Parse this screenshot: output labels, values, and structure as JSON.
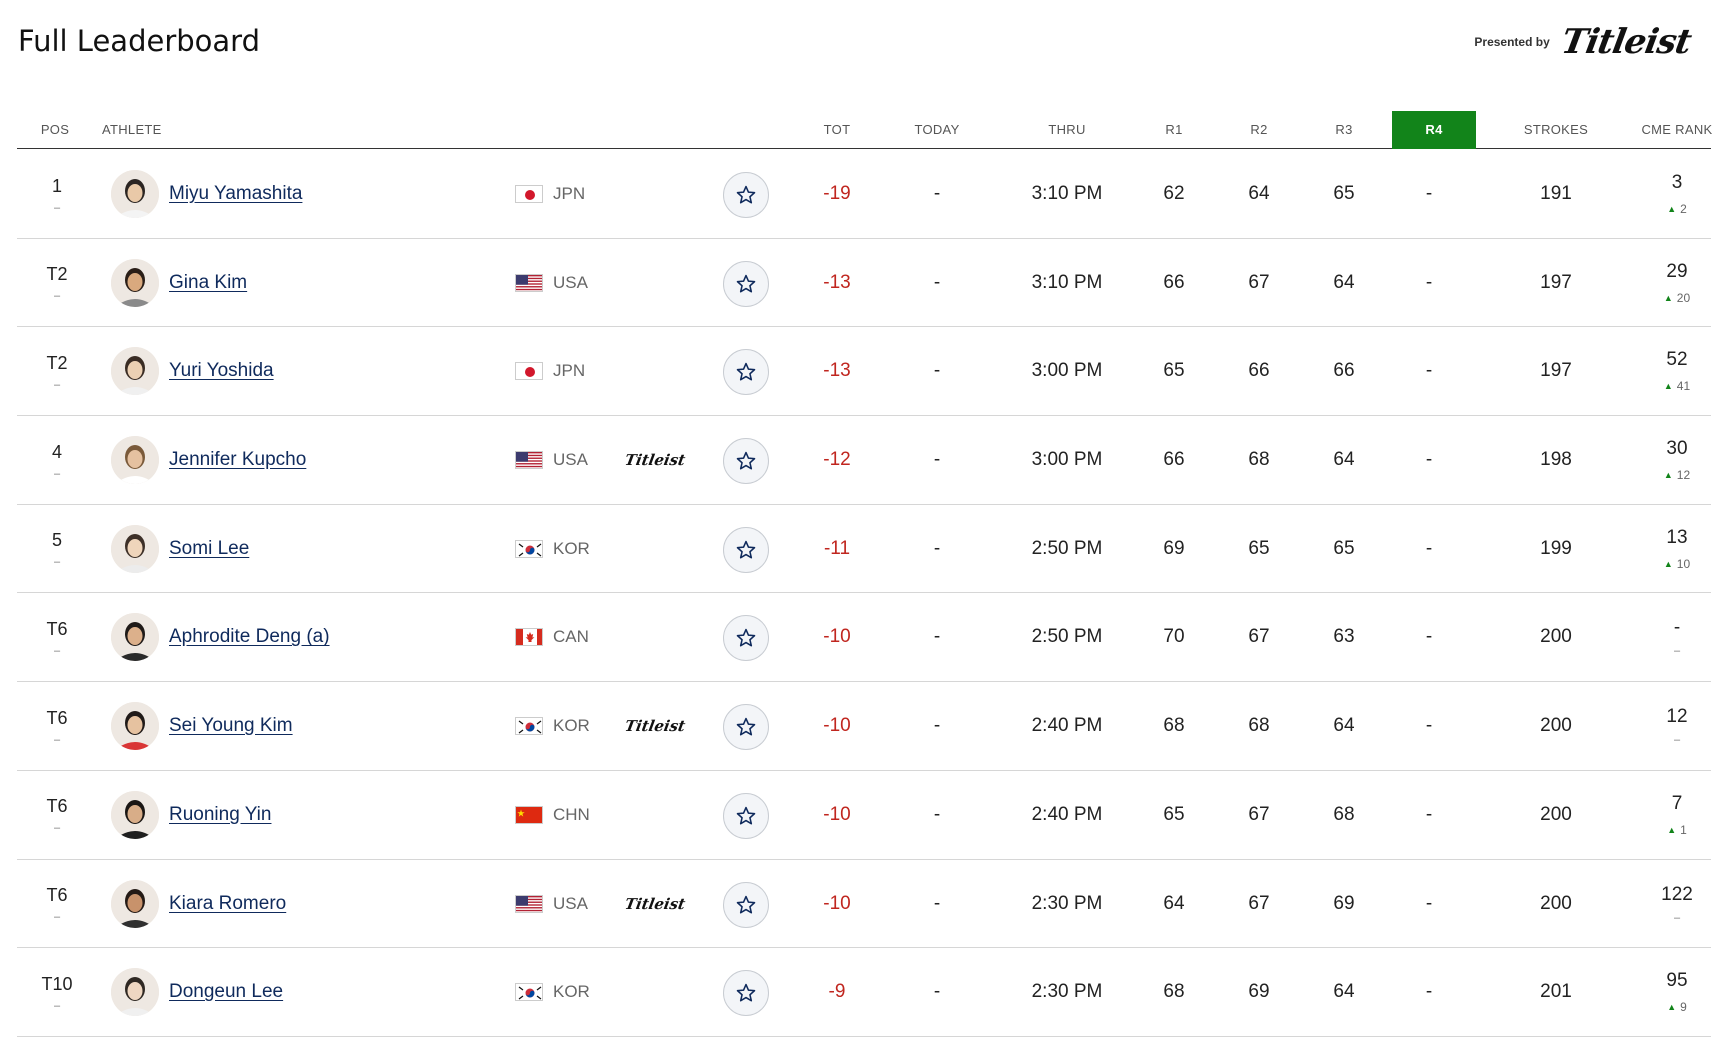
{
  "header": {
    "title": "Full Leaderboard",
    "presented_by": "Presented by",
    "sponsor": "Titleist"
  },
  "columns": [
    "POS",
    "ATHLETE",
    "TOT",
    "TODAY",
    "THRU",
    "R1",
    "R2",
    "R3",
    "R4",
    "STROKES",
    "CME RANK"
  ],
  "active_column": "R4",
  "colors": {
    "accent_green": "#12841a",
    "score_red": "#c0261f",
    "name_navy": "#0f2a5c"
  },
  "rows": [
    {
      "pos": "1",
      "sub": "–",
      "name": "Miyu Yamashita",
      "country": "JPN",
      "brand": "",
      "tot": "-19",
      "today": "-",
      "thru": "3:10 PM",
      "r1": "62",
      "r2": "64",
      "r3": "65",
      "r4": "-",
      "strokes": "191",
      "cme": "3",
      "cme_move": "2",
      "cme_dir": "up"
    },
    {
      "pos": "T2",
      "sub": "–",
      "name": "Gina Kim",
      "country": "USA",
      "brand": "",
      "tot": "-13",
      "today": "-",
      "thru": "3:10 PM",
      "r1": "66",
      "r2": "67",
      "r3": "64",
      "r4": "-",
      "strokes": "197",
      "cme": "29",
      "cme_move": "20",
      "cme_dir": "up"
    },
    {
      "pos": "T2",
      "sub": "–",
      "name": "Yuri Yoshida",
      "country": "JPN",
      "brand": "",
      "tot": "-13",
      "today": "-",
      "thru": "3:00 PM",
      "r1": "65",
      "r2": "66",
      "r3": "66",
      "r4": "-",
      "strokes": "197",
      "cme": "52",
      "cme_move": "41",
      "cme_dir": "up"
    },
    {
      "pos": "4",
      "sub": "–",
      "name": "Jennifer Kupcho",
      "country": "USA",
      "brand": "Titleist",
      "tot": "-12",
      "today": "-",
      "thru": "3:00 PM",
      "r1": "66",
      "r2": "68",
      "r3": "64",
      "r4": "-",
      "strokes": "198",
      "cme": "30",
      "cme_move": "12",
      "cme_dir": "up"
    },
    {
      "pos": "5",
      "sub": "–",
      "name": "Somi Lee",
      "country": "KOR",
      "brand": "",
      "tot": "-11",
      "today": "-",
      "thru": "2:50 PM",
      "r1": "69",
      "r2": "65",
      "r3": "65",
      "r4": "-",
      "strokes": "199",
      "cme": "13",
      "cme_move": "10",
      "cme_dir": "up"
    },
    {
      "pos": "T6",
      "sub": "–",
      "name": "Aphrodite Deng (a)",
      "country": "CAN",
      "brand": "",
      "tot": "-10",
      "today": "-",
      "thru": "2:50 PM",
      "r1": "70",
      "r2": "67",
      "r3": "63",
      "r4": "-",
      "strokes": "200",
      "cme": "-",
      "cme_move": "",
      "cme_dir": "none"
    },
    {
      "pos": "T6",
      "sub": "–",
      "name": "Sei Young Kim",
      "country": "KOR",
      "brand": "Titleist",
      "tot": "-10",
      "today": "-",
      "thru": "2:40 PM",
      "r1": "68",
      "r2": "68",
      "r3": "64",
      "r4": "-",
      "strokes": "200",
      "cme": "12",
      "cme_move": "",
      "cme_dir": "none"
    },
    {
      "pos": "T6",
      "sub": "–",
      "name": "Ruoning Yin",
      "country": "CHN",
      "brand": "",
      "tot": "-10",
      "today": "-",
      "thru": "2:40 PM",
      "r1": "65",
      "r2": "67",
      "r3": "68",
      "r4": "-",
      "strokes": "200",
      "cme": "7",
      "cme_move": "1",
      "cme_dir": "up"
    },
    {
      "pos": "T6",
      "sub": "–",
      "name": "Kiara Romero",
      "country": "USA",
      "brand": "Titleist",
      "tot": "-10",
      "today": "-",
      "thru": "2:30 PM",
      "r1": "64",
      "r2": "67",
      "r3": "69",
      "r4": "-",
      "strokes": "200",
      "cme": "122",
      "cme_move": "",
      "cme_dir": "none"
    },
    {
      "pos": "T10",
      "sub": "–",
      "name": "Dongeun Lee",
      "country": "KOR",
      "brand": "",
      "tot": "-9",
      "today": "-",
      "thru": "2:30 PM",
      "r1": "68",
      "r2": "69",
      "r3": "64",
      "r4": "-",
      "strokes": "201",
      "cme": "95",
      "cme_move": "9",
      "cme_dir": "up"
    }
  ]
}
